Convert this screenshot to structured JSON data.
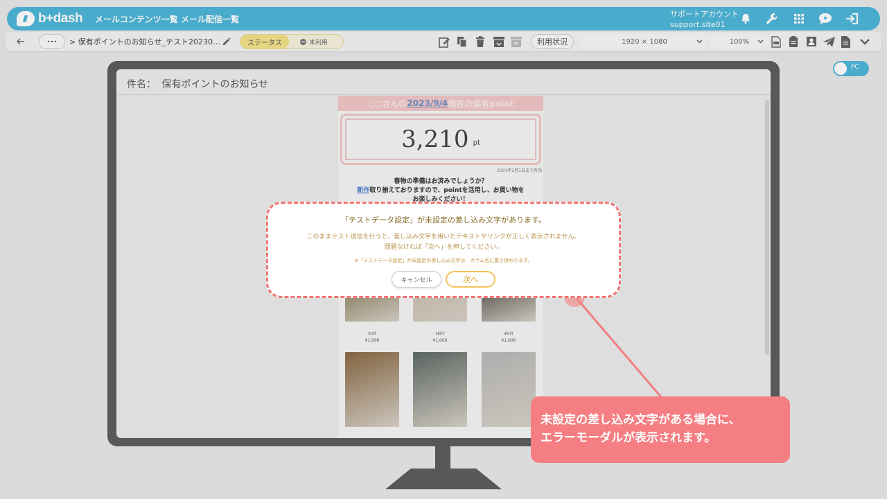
{
  "header": {
    "logo_text": "b+dash",
    "nav": [
      "メールコンテンツ一覧",
      "メール配信一覧"
    ],
    "account_name": "サポートアカウント",
    "account_id": "support.site01",
    "icons": [
      "bell-icon",
      "wrench-icon",
      "grid-icon",
      "chat-icon",
      "logout-icon"
    ]
  },
  "toolbar": {
    "more_label": "•••",
    "breadcrumb": "> 保有ポイントのお知らせ_テスト20230…",
    "status_label": "ステータス",
    "status_value": "未利用",
    "usage_label": "利用状況",
    "resolution": "1920 × 1080",
    "zoom": "100%"
  },
  "preview": {
    "subject_label": "件名：",
    "subject": "保有ポイントのお知らせ",
    "toggle_label": "PC"
  },
  "email": {
    "title_pre": "○○さんの",
    "title_date": "2023/9/4",
    "title_post": "現在の保有point",
    "points": "3,210",
    "points_unit": "pt",
    "valid_until": "2021年2月1日まで有効",
    "line1": "春物の準備はお済みでしょうか？",
    "line2_link": "新作",
    "line2_rest": "取り揃えておりますので、pointを活用し、お買い物を",
    "line3": "お楽しみください！",
    "products": [
      {
        "name": "knit",
        "price": "¥1,000",
        "color": "#7a6a45"
      },
      {
        "name": "skirt",
        "price": "¥1,000",
        "color": "#c9b7a8"
      },
      {
        "name": "skirt",
        "price": "¥1,000",
        "color": "#3a3430"
      },
      {
        "name": "",
        "price": "",
        "color": "#8b6a45"
      },
      {
        "name": "",
        "price": "",
        "color": "#5f6a66"
      },
      {
        "name": "",
        "price": "",
        "color": "#b9b9b9"
      }
    ]
  },
  "modal": {
    "title": "「テストデータ設定」が未設定の差し込み文字があります。",
    "body_line1": "このままテスト送信を行うと、差し込み文字を用いたテキストやリンクが正しく表示されません。",
    "body_line2": "問題なければ「次へ」を押してください。",
    "note": "※「テストデータ設定」が未設定の差し込み文字は、カラム名に置き換わります。",
    "cancel_label": "キャンセル",
    "next_label": "次へ"
  },
  "callout": {
    "line1": "未設定の差し込み文字がある場合に、",
    "line2": "エラーモーダルが表示されます。"
  }
}
